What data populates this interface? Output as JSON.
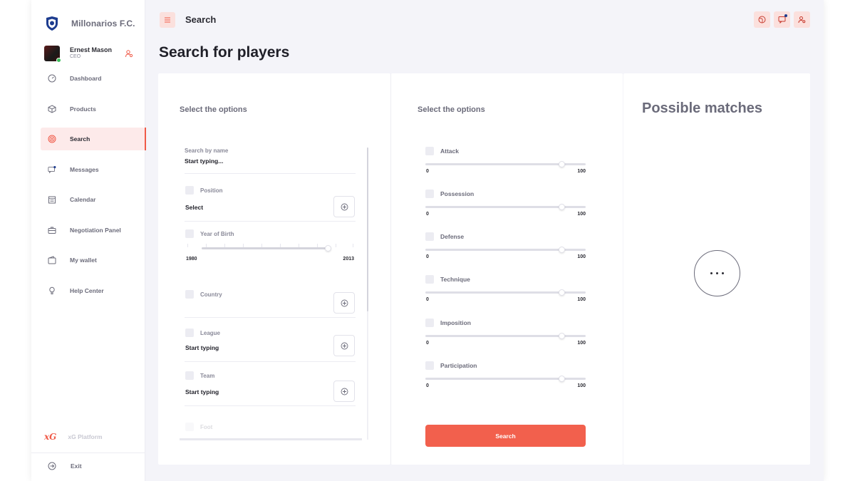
{
  "brand": {
    "name": "Millonarios F.C.",
    "logo_icon": "club-crest-icon"
  },
  "user": {
    "name": "Ernest Mason",
    "role": "CEO",
    "status_color": "#3bbd5a"
  },
  "sidebar": {
    "items": [
      {
        "label": "Dashboard",
        "icon": "gauge-icon",
        "active": false
      },
      {
        "label": "Products",
        "icon": "box-icon",
        "active": false
      },
      {
        "label": "Search",
        "icon": "target-icon",
        "active": true
      },
      {
        "label": "Messages",
        "icon": "chat-icon",
        "active": false
      },
      {
        "label": "Calendar",
        "icon": "calendar-icon",
        "active": false
      },
      {
        "label": "Negotiation Panel",
        "icon": "briefcase-icon",
        "active": false
      },
      {
        "label": "My wallet",
        "icon": "wallet-icon",
        "active": false
      },
      {
        "label": "Help Center",
        "icon": "lightbulb-icon",
        "active": false
      }
    ],
    "platform_logo": "xG",
    "platform_label": "xG Platform",
    "exit_label": "Exit"
  },
  "header": {
    "title": "Search",
    "page_title": "Search for players"
  },
  "filters": {
    "heading": "Select the options",
    "search_label": "Search by name",
    "search_value": "Start typing...",
    "position_label": "Position",
    "position_value": "Select",
    "year_label": "Year of Birth",
    "year_min": "1980",
    "year_max": "2013",
    "country_label": "Country",
    "league_label": "League",
    "league_value": "Start typing",
    "team_label": "Team",
    "team_value": "Start typing",
    "foot_label": "Foot"
  },
  "skills": {
    "heading": "Select the options",
    "min": "0",
    "max": "100",
    "items": [
      {
        "label": "Attack",
        "value_fraction": 0.85
      },
      {
        "label": "Possession",
        "value_fraction": 0.85
      },
      {
        "label": "Defense",
        "value_fraction": 0.85
      },
      {
        "label": "Technique",
        "value_fraction": 0.85
      },
      {
        "label": "Imposition",
        "value_fraction": 0.85
      },
      {
        "label": "Participation",
        "value_fraction": 0.85
      }
    ],
    "search_button": "Search"
  },
  "matches": {
    "heading": "Possible matches"
  },
  "colors": {
    "accent": "#f2604d",
    "accent_light": "#fbe0dd",
    "text": "#2b2b33",
    "muted": "#6b6b7a"
  }
}
